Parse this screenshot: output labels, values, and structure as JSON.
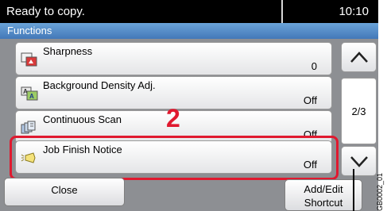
{
  "status": {
    "message": "Ready to copy.",
    "time": "10:10"
  },
  "title": "Functions",
  "items": [
    {
      "label": "Sharpness",
      "value": "0",
      "icon": "sharpness-icon"
    },
    {
      "label": "Background Density Adj.",
      "value": "Off",
      "icon": "background-density-icon"
    },
    {
      "label": "Continuous Scan",
      "value": "Off",
      "icon": "continuous-scan-icon"
    },
    {
      "label": "Job Finish Notice",
      "value": "Off",
      "icon": "job-finish-notice-icon"
    }
  ],
  "pagination": {
    "page": "2/3"
  },
  "step_number": "2",
  "buttons": {
    "close": "Close",
    "shortcut_line1": "Add/Edit",
    "shortcut_line2": "Shortcut"
  },
  "image_code": "GB0002_01",
  "colors": {
    "highlight": "#e0192f",
    "titlebar": "#5a90c9",
    "frame": "#8d8f93"
  }
}
